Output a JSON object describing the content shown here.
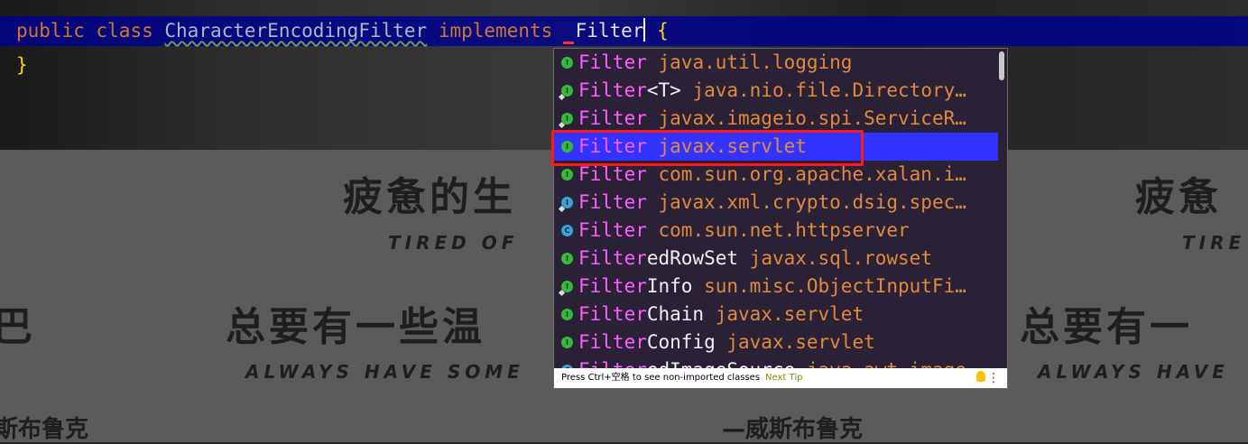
{
  "background": {
    "poster_lines": {
      "cn_title_left": "疲惫的生",
      "cn_title_right": "疲惫",
      "en_title_left": "TIRED OF",
      "en_title_right": "TIRE",
      "cn_sub_left": "总要有一些温",
      "cn_sub_right": "总要有一",
      "en_sub_left": "ALWAYS HAVE SOME",
      "en_sub_right": "ALWAYS HAVE",
      "sig_left": "斯布鲁克",
      "sig_right": "—威斯布鲁克",
      "edge_left": "巴"
    }
  },
  "editor": {
    "line1": {
      "kw_public": "public",
      "kw_class": "class",
      "class_name": "CharacterEncodingFilter",
      "kw_implements": "implements",
      "typed": "Filter",
      "open_brace": "{"
    },
    "line2": {
      "close_brace": "}"
    }
  },
  "popup": {
    "items": [
      {
        "match": "Filter",
        "rest": "",
        "pkg": "java.util.logging"
      },
      {
        "match": "Filter",
        "rest": "<T>",
        "pkg": "java.nio.file.Directory…"
      },
      {
        "match": "Filter",
        "rest": "",
        "pkg": "javax.imageio.spi.ServiceR…"
      },
      {
        "match": "Filter",
        "rest": "",
        "pkg": "javax.servlet"
      },
      {
        "match": "Filter",
        "rest": "",
        "pkg": "com.sun.org.apache.xalan.i…"
      },
      {
        "match": "Filter",
        "rest": "",
        "pkg": "javax.xml.crypto.dsig.spec…"
      },
      {
        "match": "Filter",
        "rest": "",
        "pkg": "com.sun.net.httpserver"
      },
      {
        "match": "Filter",
        "rest": "edRowSet",
        "pkg": "javax.sql.rowset"
      },
      {
        "match": "Filter",
        "rest": "Info",
        "pkg": "sun.misc.ObjectInputFi…"
      },
      {
        "match": "Filter",
        "rest": "Chain",
        "pkg": "javax.servlet"
      },
      {
        "match": "Filter",
        "rest": "Config",
        "pkg": "javax.servlet"
      },
      {
        "match": "Filter",
        "rest": "edImageSource",
        "pkg": "java.awt.image"
      }
    ],
    "icon_letter_interface": "I",
    "icon_letter_class": "C",
    "footer": {
      "hint": "Press Ctrl+空格 to see non-imported classes",
      "next_tip": "Next Tip"
    }
  }
}
